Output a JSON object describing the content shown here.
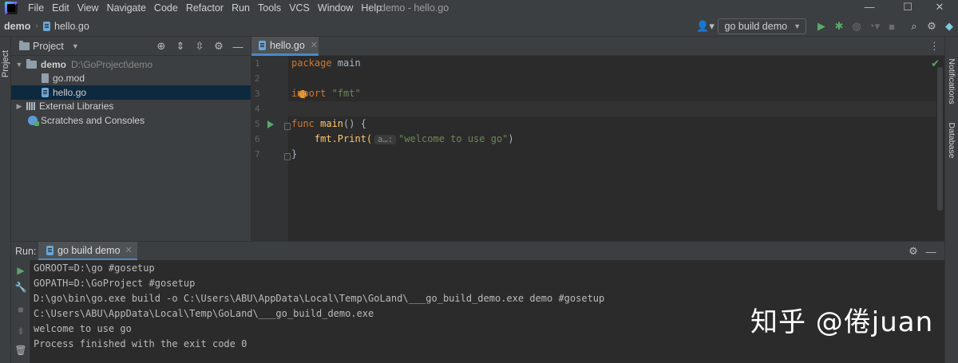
{
  "menubar": {
    "items": [
      "File",
      "Edit",
      "View",
      "Navigate",
      "Code",
      "Refactor",
      "Run",
      "Tools",
      "VCS",
      "Window",
      "Help"
    ],
    "window_title": "demo - hello.go",
    "minimize": "—",
    "maximize": "☐",
    "close": "✕"
  },
  "navbar": {
    "breadcrumb_root": "demo",
    "breadcrumb_file": "hello.go",
    "run_config": "go build demo"
  },
  "left_stripe": {
    "project_label": "Project"
  },
  "right_stripe": {
    "notifications_label": "Notifications",
    "database_label": "Database"
  },
  "project": {
    "title": "Project",
    "tree": [
      {
        "label": "demo",
        "path": "D:\\GoProject\\demo"
      },
      {
        "label": "go.mod"
      },
      {
        "label": "hello.go"
      },
      {
        "label": "External Libraries"
      },
      {
        "label": "Scratches and Consoles"
      }
    ]
  },
  "editor": {
    "tab": "hello.go",
    "line_numbers": [
      "1",
      "2",
      "3",
      "4",
      "5",
      "6",
      "7"
    ],
    "code": {
      "l1_kw": "package",
      "l1_rest": " main",
      "l3_kw": "import",
      "l3_str": " \"fmt\"",
      "l5_kw": "func",
      "l5_fn": " main",
      "l5_rest": "() {",
      "l6_call": "    fmt.Print(",
      "l6_hint": "a…:",
      "l6_str": "\"welcome to use go\"",
      "l6_end": ")",
      "l7": "}"
    }
  },
  "run": {
    "label": "Run:",
    "tab": "go build demo",
    "console_lines": [
      "GOROOT=D:\\go #gosetup",
      "GOPATH=D:\\GoProject #gosetup",
      "D:\\go\\bin\\go.exe build -o C:\\Users\\ABU\\AppData\\Local\\Temp\\GoLand\\___go_build_demo.exe demo #gosetup",
      "C:\\Users\\ABU\\AppData\\Local\\Temp\\GoLand\\___go_build_demo.exe",
      "welcome to use go",
      "Process finished with the exit code 0"
    ]
  },
  "watermark": "知乎 @倦juan",
  "colors": {
    "keyword": "#cc7832",
    "string": "#6a8759",
    "function": "#ffc66d",
    "accent": "#4a88c7",
    "run_green": "#59a869"
  }
}
